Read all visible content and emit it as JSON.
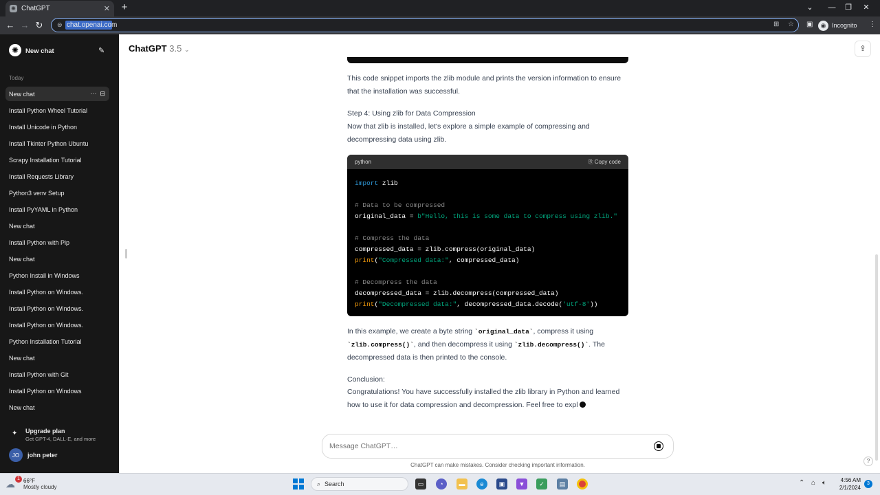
{
  "browser": {
    "tab_title": "ChatGPT",
    "url": "chat.openai.com",
    "incognito_label": "Incognito"
  },
  "sidebar": {
    "new_chat_label": "New chat",
    "section_label": "Today",
    "items": [
      "New chat",
      "Install Python Wheel Tutorial",
      "Install Unicode in Python",
      "Install Tkinter Python Ubuntu",
      "Scrapy Installation Tutorial",
      "Install Requests Library",
      "Python3 venv Setup",
      "Install PyYAML in Python",
      "New chat",
      "Install Python with Pip",
      "New chat",
      "Python Install in Windows",
      "Install Python on Windows.",
      "Install Python on Windows.",
      "Install Python on Windows.",
      "Python Installation Tutorial",
      "New chat",
      "Install Python with Git",
      "Install Python on Windows",
      "New chat"
    ],
    "upgrade_title": "Upgrade plan",
    "upgrade_subtitle": "Get GPT-4, DALL·E, and more",
    "user_initials": "JO",
    "user_name": "john peter"
  },
  "header": {
    "model_name": "ChatGPT",
    "model_version": "3.5"
  },
  "content": {
    "p1": "This code snippet imports the zlib module and prints the version information to ensure that the installation was successful.",
    "step4_title": "Step 4: Using zlib for Data Compression",
    "step4_text": "Now that zlib is installed, let's explore a simple example of compressing and decompressing data using zlib.",
    "code_lang": "python",
    "copy_label": "Copy code",
    "code": {
      "l1_kw": "import",
      "l1_rest": " zlib",
      "c1": "# Data to be compressed",
      "l3_a": "original_data = ",
      "l3_str": "b\"Hello, this is some data to compress using zlib.\"",
      "c2": "# Compress the data",
      "l5": "compressed_data = zlib.compress(original_data)",
      "l6_fn": "print",
      "l6_a": "(",
      "l6_str": "\"Compressed data:\"",
      "l6_b": ", compressed_data)",
      "c3": "# Decompress the data",
      "l8": "decompressed_data = zlib.decompress(compressed_data)",
      "l9_fn": "print",
      "l9_a": "(",
      "l9_str": "\"Decompressed data:\"",
      "l9_b": ", decompressed_data.decode(",
      "l9_str2": "'utf-8'",
      "l9_c": "))"
    },
    "expl_a": "In this example, we create a byte string ",
    "expl_code1": "`original_data`",
    "expl_b": ", compress it using ",
    "expl_code2": "`zlib.compress()`",
    "expl_c": ", and then decompress it using ",
    "expl_code3": "`zlib.decompress()`",
    "expl_d": ". The decompressed data is then printed to the console.",
    "conclusion_title": "Conclusion:",
    "conclusion_text": "Congratulations! You have successfully installed the zlib library in Python and learned how to use it for data compression and decompression. Feel free to expl"
  },
  "composer": {
    "placeholder": "Message ChatGPT…",
    "disclaimer": "ChatGPT can make mistakes. Consider checking important information."
  },
  "taskbar": {
    "temp": "66°F",
    "weather": "Mostly cloudy",
    "weather_badge": "1",
    "search_label": "Search",
    "time": "4:56 AM",
    "date": "2/1/2024",
    "notif_count": "3"
  }
}
